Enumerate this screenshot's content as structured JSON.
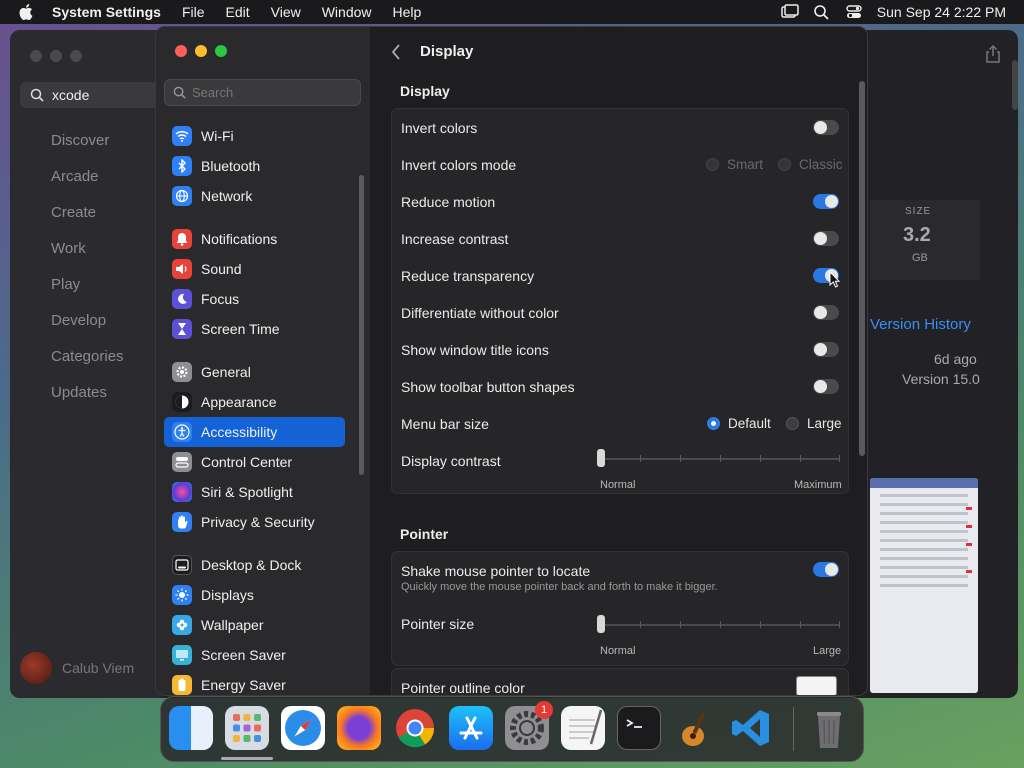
{
  "menubar": {
    "app_name": "System Settings",
    "menus": [
      "File",
      "Edit",
      "View",
      "Window",
      "Help"
    ],
    "datetime": "Sun Sep 24  2:22 PM"
  },
  "background_app": {
    "search_value": "xcode",
    "nav": [
      "Discover",
      "Arcade",
      "Create",
      "Work",
      "Play",
      "Develop",
      "Categories",
      "Updates"
    ],
    "user": "Calub Viem",
    "size_label": "SIZE",
    "size_value": "3.2",
    "size_unit": "GB",
    "version_history": "Version History",
    "updated_ago": "6d ago",
    "version": "Version 15.0"
  },
  "settings": {
    "search_placeholder": "Search",
    "sidebar": [
      {
        "label": "Wi-Fi",
        "icon": "wifi-icon",
        "color": "#2f7ff5"
      },
      {
        "label": "Bluetooth",
        "icon": "bluetooth-icon",
        "color": "#2f7ff5"
      },
      {
        "label": "Network",
        "icon": "globe-icon",
        "color": "#2f7ff5"
      },
      {
        "label": "Notifications",
        "icon": "bell-icon",
        "color": "#e8433a"
      },
      {
        "label": "Sound",
        "icon": "speaker-icon",
        "color": "#e8433a"
      },
      {
        "label": "Focus",
        "icon": "moon-icon",
        "color": "#5d4fd6"
      },
      {
        "label": "Screen Time",
        "icon": "hourglass-icon",
        "color": "#5d4fd6"
      },
      {
        "label": "General",
        "icon": "gear-icon",
        "color": "#8e8e93"
      },
      {
        "label": "Appearance",
        "icon": "appearance-icon",
        "color": "#1c1c1e"
      },
      {
        "label": "Accessibility",
        "icon": "accessibility-icon",
        "color": "#2f7ff5"
      },
      {
        "label": "Control Center",
        "icon": "control-center-icon",
        "color": "#8e8e93"
      },
      {
        "label": "Siri & Spotlight",
        "icon": "siri-icon",
        "color": "#b03fd1"
      },
      {
        "label": "Privacy & Security",
        "icon": "hand-icon",
        "color": "#2f7ff5"
      },
      {
        "label": "Desktop & Dock",
        "icon": "dock-icon",
        "color": "#1c1c1e"
      },
      {
        "label": "Displays",
        "icon": "sun-icon",
        "color": "#2f7ff5"
      },
      {
        "label": "Wallpaper",
        "icon": "flower-icon",
        "color": "#38a8e8"
      },
      {
        "label": "Screen Saver",
        "icon": "screensaver-icon",
        "color": "#38b0d8"
      },
      {
        "label": "Energy Saver",
        "icon": "battery-icon",
        "color": "#f5b833"
      }
    ],
    "active_item": "Accessibility",
    "header_title": "Display",
    "display_section": "Display",
    "rows": {
      "invert_colors": "Invert colors",
      "invert_colors_mode": "Invert colors mode",
      "mode_smart": "Smart",
      "mode_classic": "Classic",
      "reduce_motion": "Reduce motion",
      "increase_contrast": "Increase contrast",
      "reduce_transparency": "Reduce transparency",
      "differentiate": "Differentiate without color",
      "title_icons": "Show window title icons",
      "toolbar_shapes": "Show toolbar button shapes",
      "menu_bar_size": "Menu bar size",
      "menu_default": "Default",
      "menu_large": "Large",
      "display_contrast": "Display contrast",
      "contrast_min": "Normal",
      "contrast_max": "Maximum"
    },
    "pointer_section": "Pointer",
    "pointer": {
      "shake": "Shake mouse pointer to locate",
      "shake_sub": "Quickly move the mouse pointer back and forth to make it bigger.",
      "pointer_size": "Pointer size",
      "size_min": "Normal",
      "size_max": "Large",
      "outline_color": "Pointer outline color"
    }
  },
  "dock": {
    "apps": [
      "Finder",
      "Launchpad",
      "Safari",
      "Firefox",
      "Chrome",
      "App Store",
      "System Settings",
      "TextEdit",
      "Terminal",
      "GarageBand",
      "Visual Studio Code"
    ],
    "settings_badge": "1"
  }
}
